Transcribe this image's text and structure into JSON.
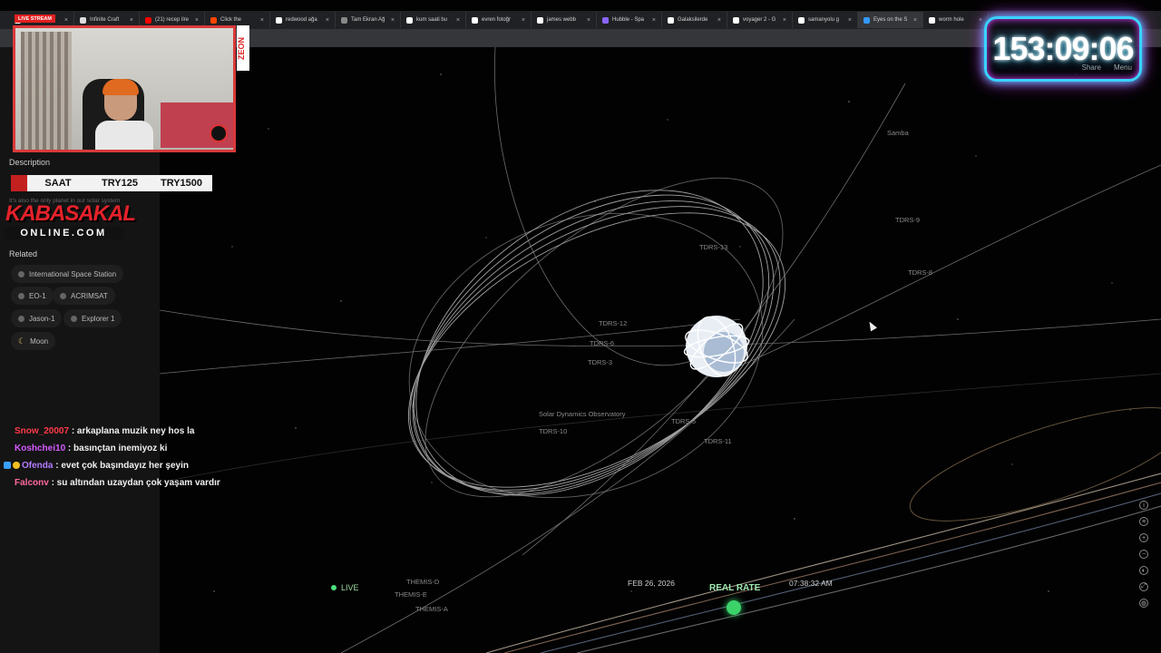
{
  "browser": {
    "tabs": [
      {
        "label": "Infinite Craft",
        "color": "#ffffff",
        "active": false
      },
      {
        "label": "Infinite Craft",
        "color": "#dddddd",
        "active": false
      },
      {
        "label": "(21) recep ilre",
        "color": "#ff0000",
        "active": false
      },
      {
        "label": "Click the",
        "color": "#ff4400",
        "active": false
      },
      {
        "label": "redwood ağa",
        "color": "#ffffff",
        "active": false
      },
      {
        "label": "Tam Ekran Ağ",
        "color": "#888888",
        "active": false
      },
      {
        "label": "kum saati bu",
        "color": "#ffffff",
        "active": false
      },
      {
        "label": "evren fotoğr",
        "color": "#ffffff",
        "active": false
      },
      {
        "label": "james webb",
        "color": "#ffffff",
        "active": false
      },
      {
        "label": "Hubble - Spa",
        "color": "#8866ff",
        "active": false
      },
      {
        "label": "Galaksilerde",
        "color": "#ffffff",
        "active": false
      },
      {
        "label": "voyager 2 - G",
        "color": "#ffffff",
        "active": false
      },
      {
        "label": "samanyolu g",
        "color": "#ffffff",
        "active": false
      },
      {
        "label": "Eyes on the S",
        "color": "#3399ff",
        "active": true
      },
      {
        "label": "worm hole",
        "color": "#ffffff",
        "active": false
      }
    ]
  },
  "overlay": {
    "live_badge": "LIVE STREAM",
    "zeon": "ZEON",
    "timer": "153:09:06",
    "timer_share": "Share",
    "timer_menu": "Menu",
    "price": {
      "label": "SAAT",
      "v1": "TRY125",
      "v2": "TRY1500"
    },
    "kabasakal": {
      "title": "KABASAKAL",
      "sub": "ONLINE.COM"
    }
  },
  "panel": {
    "description_title": "Description",
    "description_line": "It's also the only planet in our solar system",
    "related_title": "Related",
    "related": [
      "International Space Station",
      "EO-1",
      "ACRIMSAT",
      "Jason-1",
      "Explorer 1",
      "Moon"
    ]
  },
  "chat": [
    {
      "user": "Snow_20007",
      "text": ": arkaplana muzik ney hos la",
      "color": "#ff3a4a"
    },
    {
      "user": "Koshchei10",
      "text": ": basınçtan inemiyoz ki",
      "color": "#d45cff"
    },
    {
      "user": "Ofenda",
      "text": ": evet çok başındayız her şeyin",
      "color": "#b37bff"
    },
    {
      "user": "Falconv",
      "text": ": su altından uzaydan çok yaşam vardır",
      "color": "#ff6aa0"
    }
  ],
  "scene": {
    "labels": [
      "Samba",
      "TDRS-9",
      "TDRS-8",
      "TDRS-13",
      "TDRS-12",
      "TDRS-6",
      "TDRS-3",
      "Solar Dynamics Observatory",
      "TDRS-10",
      "TDRS-5",
      "TDRS-11",
      "THEMIS-D",
      "THEMIS-E",
      "THEMIS-A"
    ],
    "live": "LIVE",
    "date": "FEB 26, 2026",
    "rate": "REAL RATE",
    "time": "07:38:32 AM"
  }
}
